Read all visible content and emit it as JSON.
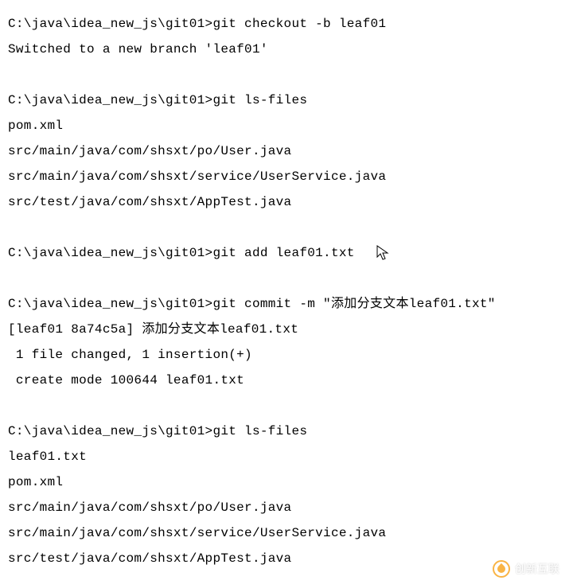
{
  "terminal": {
    "prompt": "C:\\java\\idea_new_js\\git01>",
    "blocks": [
      {
        "cmd": "git checkout -b leaf01",
        "output": [
          "Switched to a new branch 'leaf01'"
        ]
      },
      {
        "cmd": "git ls-files",
        "output": [
          "pom.xml",
          "src/main/java/com/shsxt/po/User.java",
          "src/main/java/com/shsxt/service/UserService.java",
          "src/test/java/com/shsxt/AppTest.java"
        ]
      },
      {
        "cmd": "git add leaf01.txt",
        "cursor_after": true,
        "output": []
      },
      {
        "cmd": "git commit -m \"添加分支文本leaf01.txt\"",
        "output": [
          "[leaf01 8a74c5a] 添加分支文本leaf01.txt",
          " 1 file changed, 1 insertion(+)",
          " create mode 100644 leaf01.txt"
        ]
      },
      {
        "cmd": "git ls-files",
        "output": [
          "leaf01.txt",
          "pom.xml",
          "src/main/java/com/shsxt/po/User.java",
          "src/main/java/com/shsxt/service/UserService.java",
          "src/test/java/com/shsxt/AppTest.java"
        ]
      }
    ]
  },
  "watermark": {
    "text": "创新互联"
  }
}
